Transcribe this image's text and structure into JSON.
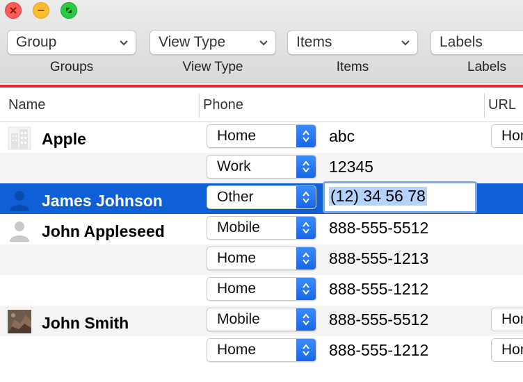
{
  "toolbar": {
    "popups": [
      {
        "value": "Group",
        "label": "Groups"
      },
      {
        "value": "View Type",
        "label": "View Type"
      },
      {
        "value": "Items",
        "label": "Items"
      },
      {
        "value": "Labels",
        "label": "Labels"
      }
    ]
  },
  "columns": {
    "name": "Name",
    "phone": "Phone",
    "url": "URL"
  },
  "rows": [
    {
      "name": "Apple",
      "phone_type": "Home",
      "phone_value": "abc",
      "url": "Hom"
    },
    {
      "name": "",
      "phone_type": "Work",
      "phone_value": "12345",
      "url": ""
    },
    {
      "name": "James Johnson",
      "phone_type": "Other",
      "phone_value": "(12) 34 56 78",
      "url": ""
    },
    {
      "name": "John Appleseed",
      "phone_type": "Mobile",
      "phone_value": "888-555-5512",
      "url": ""
    },
    {
      "name": "",
      "phone_type": "Home",
      "phone_value": "888-555-1213",
      "url": ""
    },
    {
      "name": "",
      "phone_type": "Home",
      "phone_value": "888-555-1212",
      "url": ""
    },
    {
      "name": "John Smith",
      "phone_type": "Mobile",
      "phone_value": "888-555-5512",
      "url": "Hom"
    },
    {
      "name": "",
      "phone_type": "Home",
      "phone_value": "888-555-1212",
      "url": "Hom"
    }
  ],
  "colors": {
    "selection": "#0f5fd7",
    "accent_line": "#e5282b",
    "stepper": "#1767e6"
  }
}
